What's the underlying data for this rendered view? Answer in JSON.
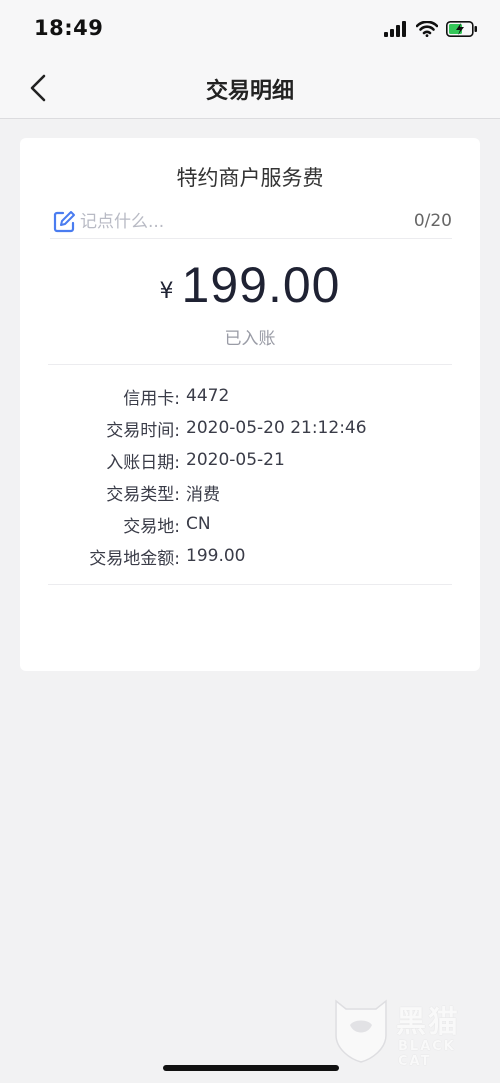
{
  "status_bar": {
    "time": "18:49"
  },
  "nav": {
    "title": "交易明细"
  },
  "card": {
    "merchant": "特约商户服务费",
    "note_placeholder": "记点什么...",
    "note_count": "0/20",
    "currency_symbol": "¥",
    "amount": "199.00",
    "status": "已入账"
  },
  "details": [
    {
      "label": "信用卡:",
      "value": "4472"
    },
    {
      "label": "交易时间:",
      "value": "2020-05-20 21:12:46"
    },
    {
      "label": "入账日期:",
      "value": "2020-05-21"
    },
    {
      "label": "交易类型:",
      "value": "消费"
    },
    {
      "label": "交易地:",
      "value": "CN"
    },
    {
      "label": "交易地金额:",
      "value": "199.00"
    }
  ],
  "watermark": {
    "brand_cn": "黑猫",
    "brand_en": "BLACK CAT"
  },
  "colors": {
    "accent": "#4a7cf0",
    "battery": "#34c759",
    "background": "#f2f2f3"
  }
}
